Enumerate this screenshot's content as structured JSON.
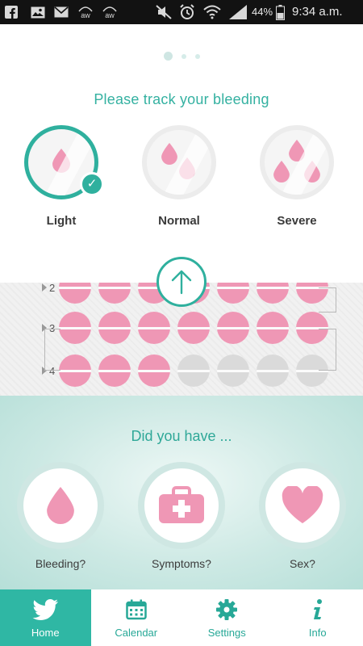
{
  "status_bar": {
    "notification_icons": [
      "facebook-icon",
      "image-icon",
      "mail-icon",
      "aw-icon",
      "aw-icon"
    ],
    "aw1": "aw",
    "aw2": "aw",
    "battery": "44%",
    "time": "9:34 a.m."
  },
  "pager": {
    "count": 3,
    "active": 0
  },
  "track": {
    "title": "Please track your bleeding",
    "options": [
      {
        "label": "Light",
        "drops": 1,
        "selected": true
      },
      {
        "label": "Normal",
        "drops": 2,
        "selected": false
      },
      {
        "label": "Severe",
        "drops": 3,
        "selected": false
      }
    ]
  },
  "pill_grid": {
    "rows": [
      {
        "label": "2",
        "filled": 7
      },
      {
        "label": "3",
        "filled": 7
      },
      {
        "label": "4",
        "filled": 3
      }
    ],
    "colors": {
      "filled": "#ef97b5",
      "empty": "#dadada",
      "band": "#fbfbfb"
    }
  },
  "did_you_have": {
    "title": "Did you have ...",
    "items": [
      {
        "label": "Bleeding?",
        "icon": "drop-icon"
      },
      {
        "label": "Symptoms?",
        "icon": "medical-kit-icon"
      },
      {
        "label": "Sex?",
        "icon": "heart-icon"
      }
    ]
  },
  "nav": {
    "items": [
      {
        "label": "Home",
        "icon": "bird-icon",
        "active": true
      },
      {
        "label": "Calendar",
        "icon": "calendar-icon",
        "active": false
      },
      {
        "label": "Settings",
        "icon": "gear-icon",
        "active": false
      },
      {
        "label": "Info",
        "icon": "info-icon",
        "active": false
      }
    ]
  },
  "colors": {
    "accent": "#2fb09e",
    "pink": "#ef97b5",
    "nav_active": "#2fb7a4"
  }
}
